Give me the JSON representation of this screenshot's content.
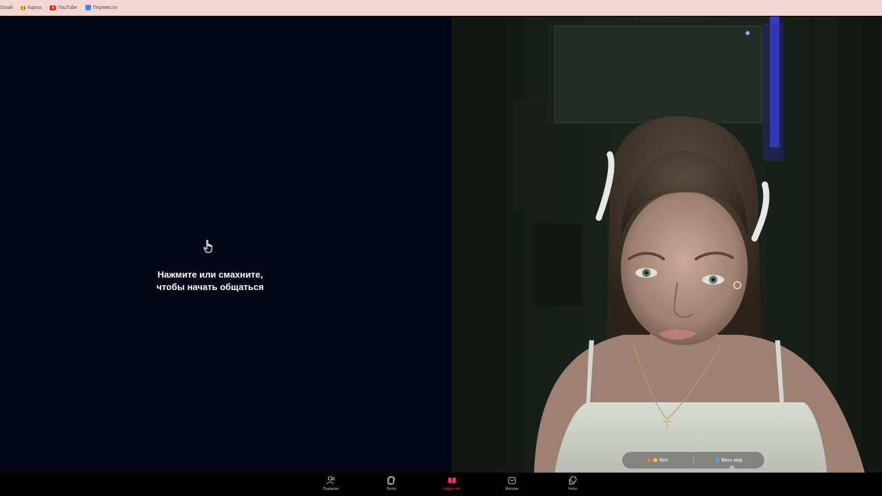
{
  "bookmarks": [
    {
      "label": "Gmail",
      "icon": "gmail-icon"
    },
    {
      "label": "Карты",
      "icon": "maps-icon"
    },
    {
      "label": "YouTube",
      "icon": "youtube-icon"
    },
    {
      "label": "Перевести",
      "icon": "translate-icon"
    }
  ],
  "left_pane": {
    "prompt_line1": "Нажмите или смахните,",
    "prompt_line2": "чтобы начать общаться",
    "icon": "hand-pointer-icon"
  },
  "region_selector": {
    "all_label": "Все",
    "world_label": "Весь мир"
  },
  "nav": {
    "items": [
      {
        "label": "Подписки",
        "icon": "people-icon",
        "active": false
      },
      {
        "label": "Лента",
        "icon": "feed-icon",
        "active": false
      },
      {
        "label": "Видео-чат",
        "icon": "video-chat-icon",
        "active": true
      },
      {
        "label": "Магазин",
        "icon": "shop-icon",
        "active": false
      },
      {
        "label": "Чаты",
        "icon": "chats-icon",
        "active": false
      }
    ]
  },
  "colors": {
    "accent": "#ff2d6f",
    "left_bg": "#030614",
    "bookmarks_bg": "#f3d7d4"
  }
}
